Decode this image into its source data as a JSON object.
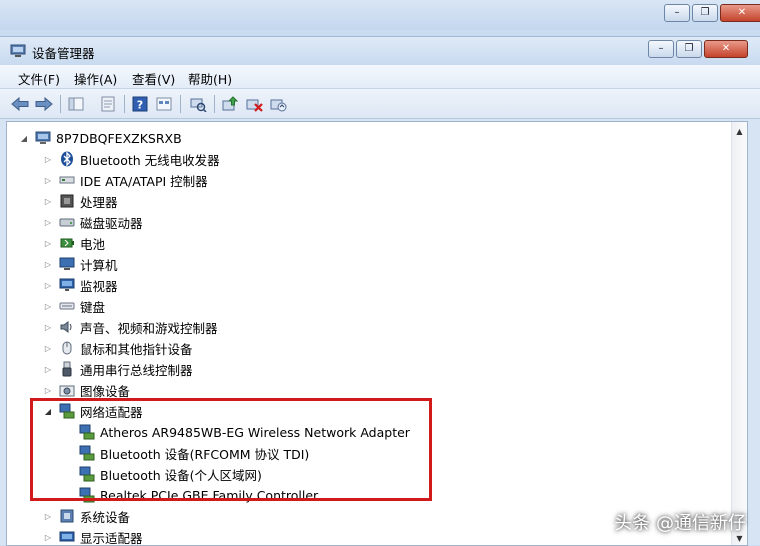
{
  "window": {
    "title": "设备管理器",
    "menus": [
      "文件(F)",
      "操作(A)",
      "查看(V)",
      "帮助(H)"
    ]
  },
  "tree": {
    "root": "8P7DBQFEXZKSRXB",
    "categories": [
      {
        "label": "Bluetooth 无线电收发器",
        "icon": "bluetooth-icon"
      },
      {
        "label": "IDE ATA/ATAPI 控制器",
        "icon": "ide-controller-icon"
      },
      {
        "label": "处理器",
        "icon": "processor-icon"
      },
      {
        "label": "磁盘驱动器",
        "icon": "disk-drive-icon"
      },
      {
        "label": "电池",
        "icon": "battery-icon"
      },
      {
        "label": "计算机",
        "icon": "computer-icon"
      },
      {
        "label": "监视器",
        "icon": "monitor-icon"
      },
      {
        "label": "键盘",
        "icon": "keyboard-icon"
      },
      {
        "label": "声音、视频和游戏控制器",
        "icon": "sound-icon"
      },
      {
        "label": "鼠标和其他指针设备",
        "icon": "mouse-icon"
      },
      {
        "label": "通用串行总线控制器",
        "icon": "usb-icon"
      },
      {
        "label": "图像设备",
        "icon": "camera-icon"
      },
      {
        "label": "网络适配器",
        "icon": "network-icon",
        "expanded": true
      },
      {
        "label": "系统设备",
        "icon": "system-icon"
      },
      {
        "label": "显示适配器",
        "icon": "display-adapter-icon"
      }
    ],
    "network_adapters": [
      "Atheros AR9485WB-EG Wireless Network Adapter",
      "Bluetooth 设备(RFCOMM 协议 TDI)",
      "Bluetooth 设备(个人区域网)",
      "Realtek PCIe GBE Family Controller"
    ]
  },
  "watermark": "头条 @通信新仔",
  "colors": {
    "highlight": "#d11a1a",
    "titlebar": "#c8daf0"
  }
}
